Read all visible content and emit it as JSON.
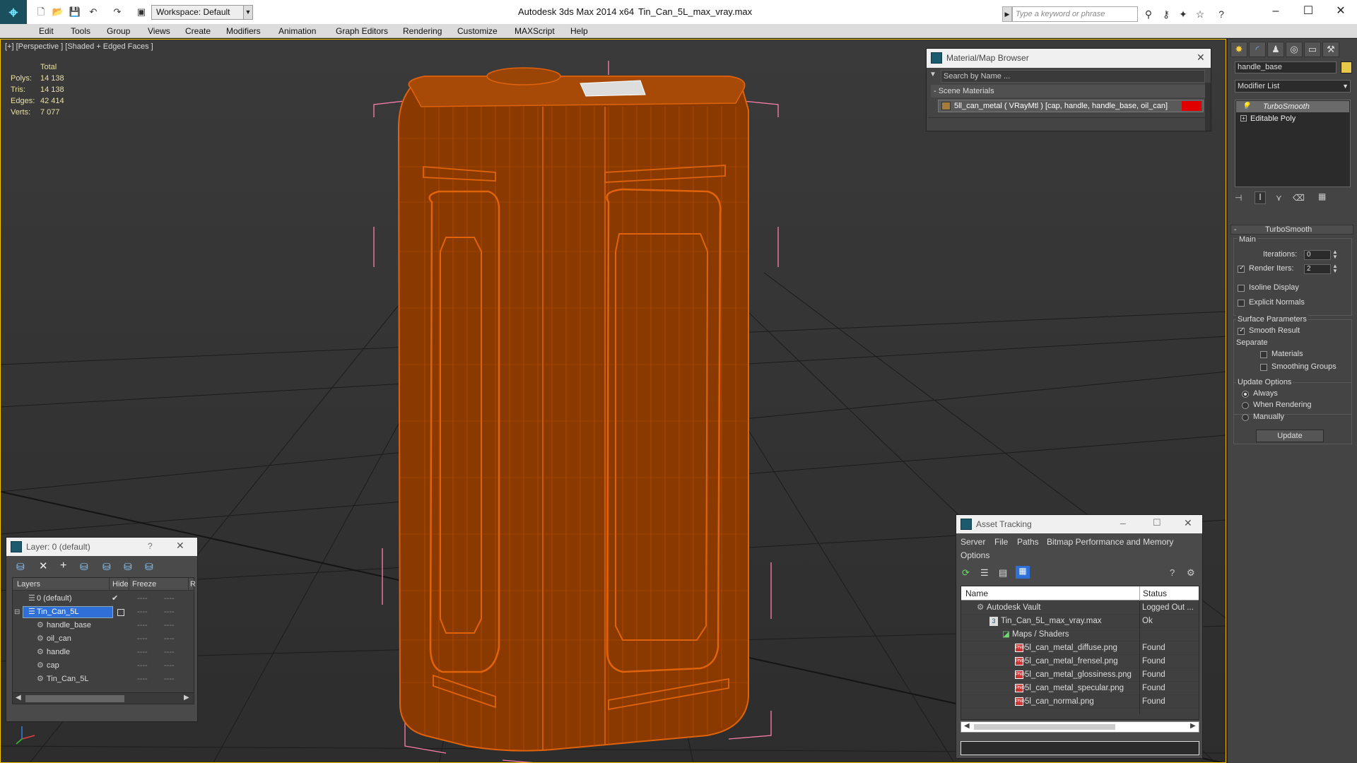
{
  "titlebar": {
    "app_title": "Autodesk 3ds Max  2014 x64",
    "file_title": "Tin_Can_5L_max_vray.max",
    "workspace": "Workspace: Default",
    "search_placeholder": "Type a keyword or phrase"
  },
  "menu": [
    "Edit",
    "Tools",
    "Group",
    "Views",
    "Create",
    "Modifiers",
    "Animation",
    "Graph Editors",
    "Rendering",
    "Customize",
    "MAXScript",
    "Help"
  ],
  "viewport": {
    "label": "[+] [Perspective ] [Shaded + Edged Faces ]",
    "stats_header": "Total",
    "stats": [
      {
        "label": "Polys:",
        "value": "14 138"
      },
      {
        "label": "Tris:",
        "value": "14 138"
      },
      {
        "label": "Edges:",
        "value": "42 414"
      },
      {
        "label": "Verts:",
        "value": "7 077"
      }
    ]
  },
  "material_browser": {
    "title": "Material/Map Browser",
    "search_placeholder": "Search by Name ...",
    "section": "- Scene Materials",
    "item": "5ll_can_metal  ( VRayMtl )  [cap, handle, handle_base, oil_can]"
  },
  "command_panel": {
    "object_name": "handle_base",
    "object_color": "#e8c84a",
    "modifier_list": "Modifier List",
    "stack": [
      "TurboSmooth",
      "Editable Poly"
    ],
    "rollout_title": "TurboSmooth",
    "main_label": "Main",
    "iterations_label": "Iterations:",
    "iterations_value": "0",
    "render_iters_label": "Render Iters:",
    "render_iters_value": "2",
    "isoline": "Isoline Display",
    "explicit": "Explicit Normals",
    "surface_params": "Surface Parameters",
    "smooth_result": "Smooth Result",
    "separate": "Separate",
    "materials": "Materials",
    "smoothing_groups": "Smoothing Groups",
    "update_options": "Update Options",
    "always": "Always",
    "when_rendering": "When Rendering",
    "manually": "Manually",
    "update_btn": "Update"
  },
  "layer_window": {
    "title": "Layer: 0 (default)",
    "help": "?",
    "col_layers": "Layers",
    "col_hide": "Hide",
    "col_freeze": "Freeze",
    "col_r": "R",
    "rows": [
      "0 (default)",
      "Tin_Can_5L",
      "handle_base",
      "oil_can",
      "handle",
      "cap",
      "Tin_Can_5L"
    ]
  },
  "asset_tracking": {
    "title": "Asset Tracking",
    "menu": [
      "Server",
      "File",
      "Paths",
      "Bitmap Performance and Memory",
      "Options"
    ],
    "col_name": "Name",
    "col_status": "Status",
    "rows": [
      {
        "name": "Autodesk Vault",
        "status": "Logged Out ..."
      },
      {
        "name": "Tin_Can_5L_max_vray.max",
        "status": "Ok"
      },
      {
        "name": "Maps / Shaders",
        "status": ""
      },
      {
        "name": "5l_can_metal_diffuse.png",
        "status": "Found"
      },
      {
        "name": "5l_can_metal_frensel.png",
        "status": "Found"
      },
      {
        "name": "5l_can_metal_glossiness.png",
        "status": "Found"
      },
      {
        "name": "5l_can_metal_specular.png",
        "status": "Found"
      },
      {
        "name": "5l_can_normal.png",
        "status": "Found"
      }
    ]
  },
  "colors": {
    "wire": "#e0620a",
    "model_fill": "#8a3a00",
    "selection_bbox": "#ff7fae",
    "accent": "#f5c400"
  }
}
